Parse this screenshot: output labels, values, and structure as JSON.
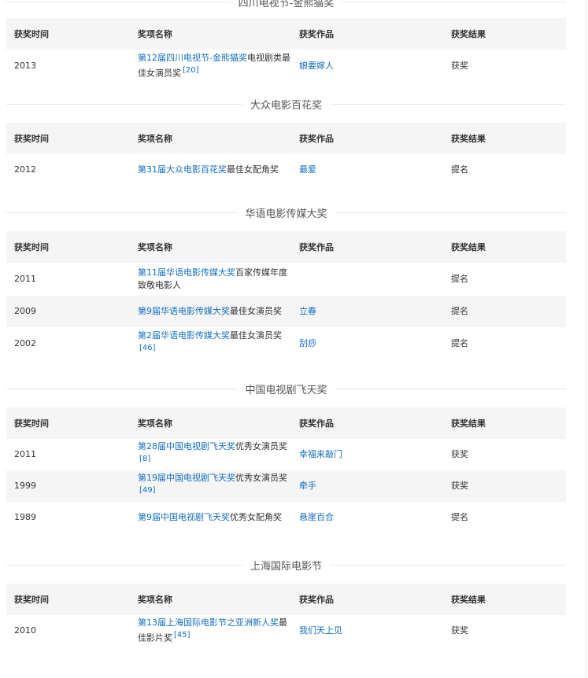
{
  "headers": {
    "time": "获奖时间",
    "award": "奖项名称",
    "work": "获奖作品",
    "result": "获奖结果"
  },
  "sections": [
    {
      "title": "四川电视节-金熊猫奖",
      "rows": [
        {
          "time": "2013",
          "award_link": "第12届四川电视节-金熊猫奖",
          "award_rest": "电视剧类最佳女演员奖",
          "ref": "[20]",
          "work": "娘要嫁人",
          "result": "获奖"
        }
      ]
    },
    {
      "title": "大众电影百花奖",
      "rows": [
        {
          "time": "2012",
          "award_link": "第31届大众电影百花奖",
          "award_rest": "最佳女配角奖",
          "ref": "",
          "work": "最爱",
          "result": "提名"
        }
      ]
    },
    {
      "title": "华语电影传媒大奖",
      "rows": [
        {
          "time": "2011",
          "award_link": "第11届华语电影传媒大奖",
          "award_rest": "百家传媒年度致敬电影人",
          "ref": "",
          "work": "",
          "result": "提名"
        },
        {
          "time": "2009",
          "award_link": "第9届华语电影传媒大奖",
          "award_rest": "最佳女演员奖",
          "ref": "",
          "work": "立春",
          "result": "提名"
        },
        {
          "time": "2002",
          "award_link": "第2届华语电影传媒大奖",
          "award_rest": "最佳女演员奖",
          "ref": "[46]",
          "work": "刮痧",
          "result": "提名"
        }
      ]
    },
    {
      "title": "中国电视剧飞天奖",
      "rows": [
        {
          "time": "2011",
          "award_link": "第28届中国电视剧飞天奖",
          "award_rest": "优秀女演员奖",
          "ref": "[8]",
          "work": "幸福来敲门",
          "result": "获奖"
        },
        {
          "time": "1999",
          "award_link": "第19届中国电视剧飞天奖",
          "award_rest": "优秀女演员奖",
          "ref": "[49]",
          "work": "牵手",
          "result": "获奖"
        },
        {
          "time": "1989",
          "award_link": "第9届中国电视剧飞天奖",
          "award_rest": "优秀女配角奖",
          "ref": "",
          "work": "悬崖百合",
          "result": "提名"
        }
      ]
    },
    {
      "title": "上海国际电影节",
      "rows": [
        {
          "time": "2010",
          "award_link": "第13届上海国际电影节之亚洲新人奖",
          "award_rest": "最佳影片奖",
          "ref": "[45]",
          "work": "我们天上见",
          "result": "获奖"
        }
      ]
    }
  ]
}
